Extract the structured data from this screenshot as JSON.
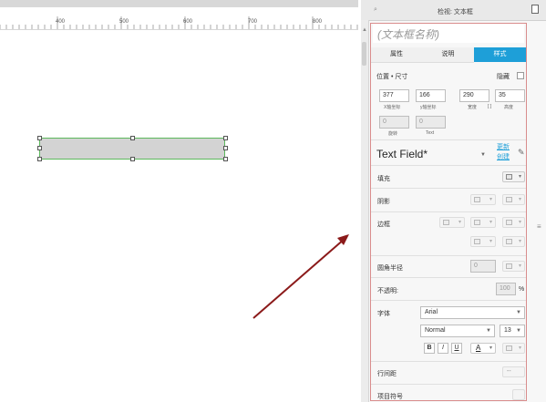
{
  "ruler": {
    "ticks": [
      "400",
      "500",
      "600",
      "700",
      "800"
    ]
  },
  "panel": {
    "title": "检视: 文本框",
    "search_icon": "search-icon",
    "doc_icon": "page-icon",
    "name_placeholder": "(文本框名称)",
    "tabs": [
      {
        "label": "属性",
        "active": false
      },
      {
        "label": "说明",
        "active": false
      },
      {
        "label": "样式",
        "active": true
      }
    ],
    "position": {
      "title": "位置 • 尺寸",
      "hidden_label": "隐藏",
      "x": "377",
      "y": "166",
      "w": "290",
      "h": "35",
      "x_label": "X轴坐标",
      "y_label": "y轴坐标",
      "w_label": "宽度",
      "h_label": "高度",
      "lock_symbol": "[ ]",
      "rotate_value": "0",
      "text_rotate_value": "0",
      "rotate_label": "旋转",
      "text_label": "Text"
    },
    "style": {
      "name": "Text Field*",
      "update_link": "更新",
      "create_link": "创建"
    },
    "rows": {
      "fill": "填充",
      "shadow": "阴影",
      "border": "边框",
      "radius": "圆角半径",
      "radius_value": "0",
      "opacity": "不透明:",
      "opacity_value": "100",
      "opacity_unit": "%",
      "font": "字体",
      "font_family": "Arial",
      "font_weight": "Normal",
      "font_size": "13",
      "bold": "B",
      "italic": "I",
      "underline": "U",
      "font_color": "A",
      "line_spacing": "行间距",
      "line_spacing_value": "--",
      "bullets": "项目符号"
    }
  }
}
